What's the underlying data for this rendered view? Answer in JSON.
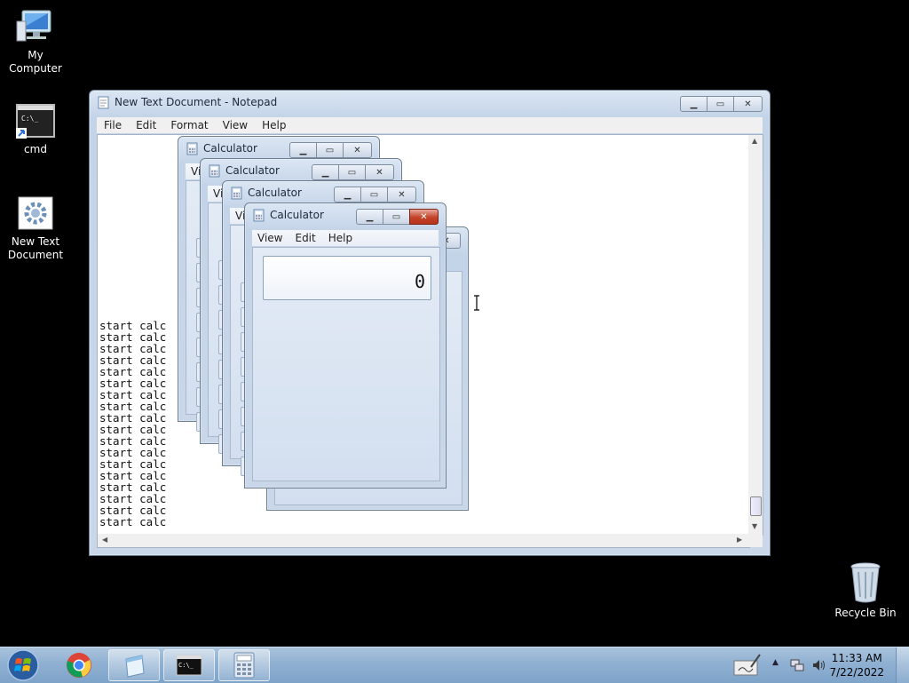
{
  "desktop": {
    "icons": [
      {
        "label": "My Computer"
      },
      {
        "label": "cmd"
      },
      {
        "label": "New Text Document"
      },
      {
        "label": "Recycle Bin"
      }
    ]
  },
  "notepad": {
    "title": "New Text Document - Notepad",
    "menu": [
      "File",
      "Edit",
      "Format",
      "View",
      "Help"
    ],
    "lines": [
      "start calc",
      "start calc",
      "start calc",
      "start calc",
      "start calc",
      "start calc",
      "start calc",
      "start calc",
      "start calc",
      "start calc",
      "start calc",
      "start calc",
      "start calc",
      "start calc",
      "start calc",
      "start calc",
      "start calc",
      "start calc"
    ]
  },
  "calculators": [
    {
      "title": "Calculator",
      "menu": [
        "Vi"
      ]
    },
    {
      "title": "Calculator",
      "menu": [
        "Vi"
      ]
    },
    {
      "title": "Calculator",
      "menu": [
        "Vi"
      ]
    },
    {
      "title": "Calculator",
      "menu": [
        "View",
        "Edit",
        "Help"
      ],
      "display": "0"
    }
  ],
  "taskbar": {
    "clock_time": "11:33 AM",
    "clock_date": "7/22/2022",
    "apps": [
      "chrome-icon",
      "notepad-icon",
      "cmd-icon",
      "calculator-icon"
    ]
  }
}
